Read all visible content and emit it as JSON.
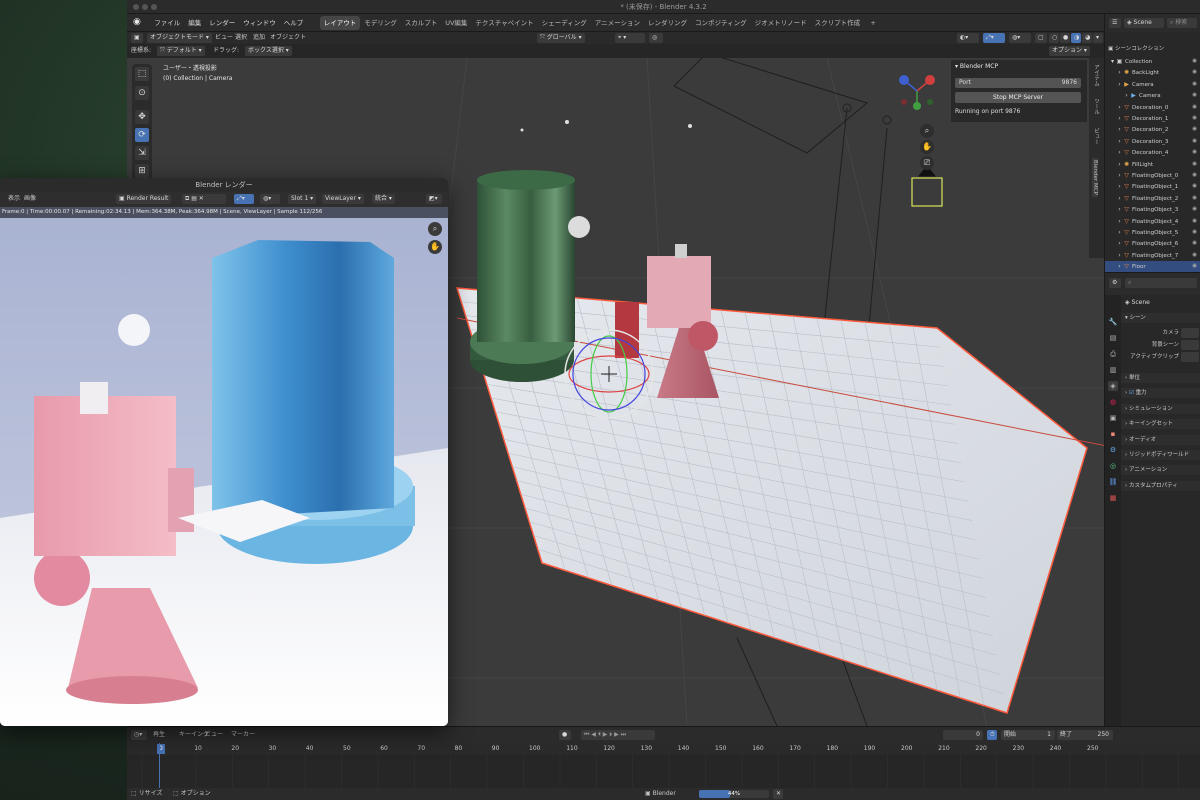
{
  "window": {
    "title": "* (未保存) - Blender 4.3.2"
  },
  "menu": {
    "items": [
      "ファイル",
      "編集",
      "レンダー",
      "ウィンドウ",
      "ヘルプ"
    ]
  },
  "workspaces": [
    "レイアウト",
    "モデリング",
    "スカルプト",
    "UV編集",
    "テクスチャペイント",
    "シェーディング",
    "アニメーション",
    "レンダリング",
    "コンポジティング",
    "ジオメトリノード",
    "スクリプト作成"
  ],
  "workspace_add": "+",
  "header": {
    "mode": "オブジェクトモード",
    "view": "ビュー",
    "select": "選択",
    "add": "追加",
    "object": "オブジェクト",
    "transform": "グローバル",
    "options": "オプション",
    "scene": "Scene",
    "search_placeholder": "検索"
  },
  "tool_settings": {
    "select_label": "座標系:",
    "orientation": "デフォルト",
    "drag_label": "ドラッグ:",
    "drag": "ボックス選択"
  },
  "overlay_text": {
    "line1": "ユーザー・透視投影",
    "line2": "(0) Collection | Camera"
  },
  "mcp": {
    "title": "Blender MCP",
    "port_label": "Port",
    "port_value": "9876",
    "stop_button": "Stop MCP Server",
    "status": "Running on port 9876"
  },
  "npanel_tabs": [
    "アイテム",
    "ツール",
    "ビュー",
    "Blender MCP"
  ],
  "outliner": {
    "header": "シーンコレクション",
    "items": [
      {
        "name": "Collection",
        "icon": "collection-icon",
        "color": "#d0d0d0",
        "depth": 0
      },
      {
        "name": "BackLight",
        "icon": "light-icon",
        "color": "#e8a848",
        "depth": 1
      },
      {
        "name": "Camera",
        "icon": "camera-icon",
        "color": "#e8a848",
        "depth": 1
      },
      {
        "name": "Camera",
        "icon": "camera-data-icon",
        "color": "#6fb0e8",
        "depth": 2
      },
      {
        "name": "Decoration_0",
        "icon": "mesh-icon",
        "color": "#e8864a",
        "depth": 1
      },
      {
        "name": "Decoration_1",
        "icon": "mesh-icon",
        "color": "#e8864a",
        "depth": 1
      },
      {
        "name": "Decoration_2",
        "icon": "mesh-icon",
        "color": "#e8864a",
        "depth": 1
      },
      {
        "name": "Decoration_3",
        "icon": "mesh-icon",
        "color": "#e8864a",
        "depth": 1
      },
      {
        "name": "Decoration_4",
        "icon": "mesh-icon",
        "color": "#e8864a",
        "depth": 1
      },
      {
        "name": "FillLight",
        "icon": "light-icon",
        "color": "#e8a848",
        "depth": 1
      },
      {
        "name": "FloatingObject_0",
        "icon": "mesh-icon",
        "color": "#e8864a",
        "depth": 1
      },
      {
        "name": "FloatingObject_1",
        "icon": "mesh-icon",
        "color": "#e8864a",
        "depth": 1
      },
      {
        "name": "FloatingObject_2",
        "icon": "mesh-icon",
        "color": "#e8864a",
        "depth": 1
      },
      {
        "name": "FloatingObject_3",
        "icon": "mesh-icon",
        "color": "#e8864a",
        "depth": 1
      },
      {
        "name": "FloatingObject_4",
        "icon": "mesh-icon",
        "color": "#e8864a",
        "depth": 1
      },
      {
        "name": "FloatingObject_5",
        "icon": "mesh-icon",
        "color": "#e8864a",
        "depth": 1
      },
      {
        "name": "FloatingObject_6",
        "icon": "mesh-icon",
        "color": "#e8864a",
        "depth": 1
      },
      {
        "name": "FloatingObject_7",
        "icon": "mesh-icon",
        "color": "#e8864a",
        "depth": 1
      },
      {
        "name": "Floor",
        "icon": "mesh-icon",
        "color": "#e8864a",
        "depth": 1,
        "selected": true
      }
    ]
  },
  "properties": {
    "scene_name": "Scene",
    "scene_section": "シーン",
    "fields": [
      "カメラ",
      "背景シーン",
      "アクティブクリップ"
    ],
    "sections": [
      {
        "label": "単位",
        "checkbox": false
      },
      {
        "label": "重力",
        "checkbox": true
      },
      {
        "label": "シミュレーション",
        "checkbox": false
      },
      {
        "label": "キーイングセット",
        "checkbox": false
      },
      {
        "label": "オーディオ",
        "checkbox": false
      },
      {
        "label": "リジッドボディワールド",
        "checkbox": false
      },
      {
        "label": "アニメーション",
        "checkbox": false
      },
      {
        "label": "カスタムプロパティ",
        "checkbox": false
      }
    ]
  },
  "timeline": {
    "menus": [
      "再生",
      "キーイング",
      "ビュー",
      "マーカー"
    ],
    "current_frame": "0",
    "start_label": "開始",
    "start": "1",
    "end_label": "終了",
    "end": "250",
    "ticks": [
      "0",
      "10",
      "20",
      "30",
      "40",
      "50",
      "60",
      "70",
      "80",
      "90",
      "100",
      "110",
      "120",
      "130",
      "140",
      "150",
      "160",
      "170",
      "180",
      "190",
      "200",
      "210",
      "220",
      "230",
      "240",
      "250"
    ]
  },
  "status": {
    "left1": "リサイズ",
    "left2": "オプション",
    "center_label": "Blender",
    "progress_text": "44%",
    "progress": 0.44
  },
  "render_window": {
    "title": "Blender レンダー",
    "menu": [
      "表示",
      "画像"
    ],
    "slot": "Render Result",
    "slot2": "Slot 1",
    "viewlayer": "ViewLayer",
    "pass": "統合",
    "info": "Frame:0 | Time:00:00.07 | Remaining:02:34.13 | Mem:364.38M, Peak:364.98M | Scene, ViewLayer | Sample 112/256"
  },
  "colors": {
    "accent": "#4772b3",
    "floor_edge": "#ff5a3c",
    "pink": "#e8a5b4",
    "green_cyl": "#3f6a48",
    "blue_cyl": "#5aa9dc"
  }
}
